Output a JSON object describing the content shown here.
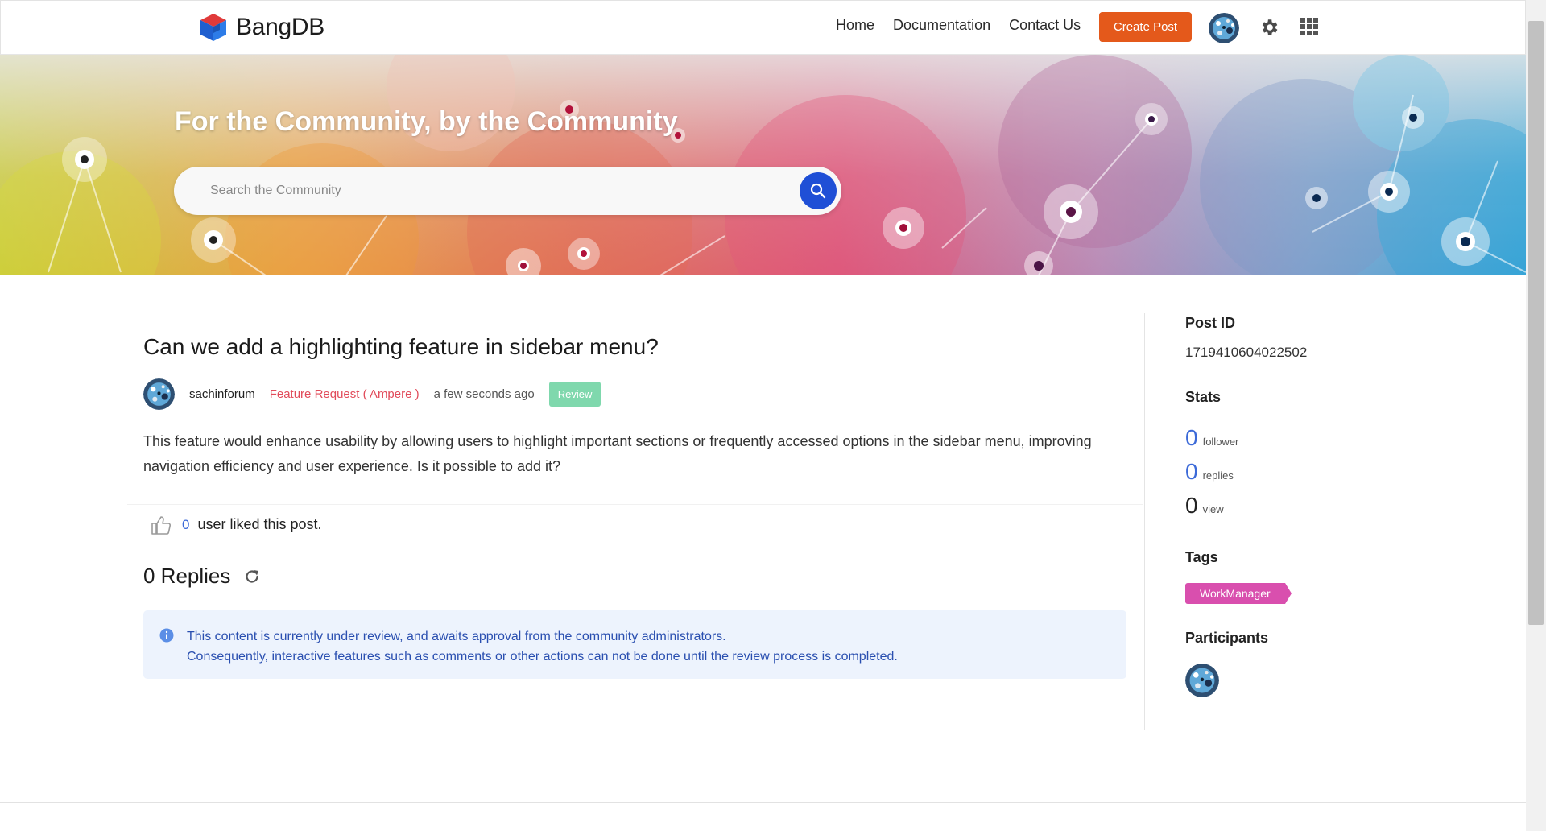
{
  "header": {
    "logo_text": "BangDB",
    "nav": [
      "Home",
      "Documentation",
      "Contact Us"
    ],
    "create_post_label": "Create Post"
  },
  "hero": {
    "title": "For the Community, by the Community",
    "search_placeholder": "Search the Community"
  },
  "post": {
    "title": "Can we add a highlighting feature in sidebar menu?",
    "author": "sachinforum",
    "category": "Feature Request ( Ampere )",
    "time": "a few seconds ago",
    "status_badge": "Review",
    "body": "This feature would enhance usability by allowing users to highlight important sections or frequently accessed options in the sidebar menu, improving navigation efficiency and user experience. Is it possible to add it?",
    "likes_count": "0",
    "likes_text": "user liked this post.",
    "replies_label": "0 Replies",
    "review_notice": {
      "line1": "This content is currently under review, and awaits approval from the community administrators.",
      "line2": "Consequently, interactive features such as comments or other actions can not be done until the review process is completed."
    }
  },
  "sidebar": {
    "post_id_label": "Post ID",
    "post_id_value": "1719410604022502",
    "stats_label": "Stats",
    "stats": [
      {
        "value": "0",
        "label": "follower"
      },
      {
        "value": "0",
        "label": "replies"
      },
      {
        "value": "0",
        "label": "view"
      }
    ],
    "tags_label": "Tags",
    "tags": [
      "WorkManager"
    ],
    "participants_label": "Participants"
  },
  "colors": {
    "accent": "#e4591b",
    "link_blue": "#3c6ad8",
    "search_button": "#1f4fd6",
    "review_badge": "#7fd8ad",
    "tag": "#d94fae",
    "category": "#e14b5a",
    "notice_bg": "#edf3fd"
  },
  "icons": [
    "bangdb-logo-icon",
    "settings-gear-icon",
    "apps-grid-icon",
    "search-icon",
    "thumbs-up-icon",
    "refresh-icon",
    "info-icon"
  ]
}
